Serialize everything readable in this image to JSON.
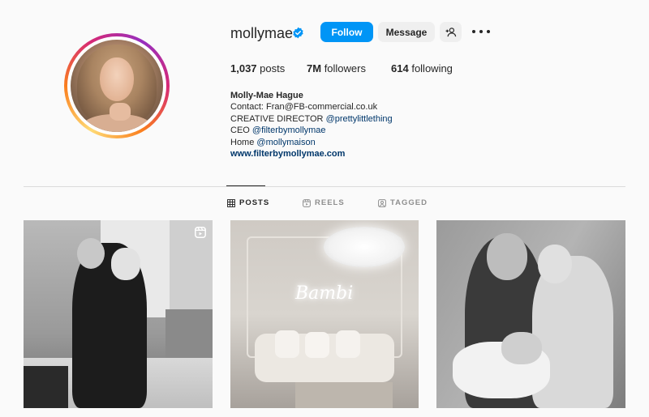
{
  "profile": {
    "username": "mollymae",
    "verified": true,
    "follow_label": "Follow",
    "message_label": "Message",
    "add_user_icon": "add-user-icon",
    "more_icon": "more-options-icon"
  },
  "stats": {
    "posts_count": "1,037",
    "posts_label": "posts",
    "followers_count": "7M",
    "followers_label": "followers",
    "following_count": "614",
    "following_label": "following"
  },
  "bio": {
    "name": "Molly-Mae Hague",
    "line1": "Contact: Fran@FB-commercial.co.uk",
    "line2_prefix": "CREATIVE DIRECTOR ",
    "line2_mention": "@prettylittlething",
    "line3_prefix": "CEO ",
    "line3_mention": "@filterbymollymae",
    "line4_prefix": "Home ",
    "line4_mention": "@mollymaison",
    "website": "www.filterbymollymae.com"
  },
  "tabs": [
    {
      "label": "POSTS",
      "icon": "grid-icon",
      "active": true
    },
    {
      "label": "REELS",
      "icon": "reels-icon",
      "active": false
    },
    {
      "label": "TAGGED",
      "icon": "tagged-icon",
      "active": false
    }
  ],
  "posts": [
    {
      "type": "reel"
    },
    {
      "type": "image",
      "neon_text": "Bambi"
    },
    {
      "type": "image"
    }
  ],
  "colors": {
    "accent": "#0095f6",
    "text": "#262626",
    "mention": "#00376b",
    "muted": "#8e8e8e"
  }
}
